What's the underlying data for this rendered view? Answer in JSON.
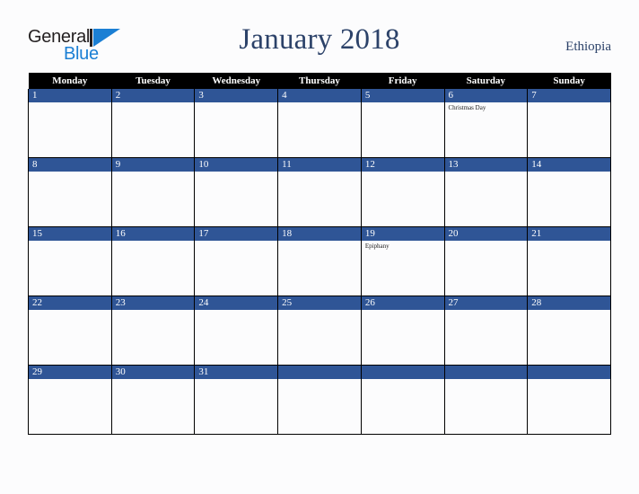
{
  "brand": {
    "name_part1": "General",
    "name_part2": "Blue",
    "mark_icon": "triangle-flag-icon",
    "color_dark": "#231f20",
    "color_blue": "#1b7fd4"
  },
  "header": {
    "title": "January 2018",
    "country": "Ethiopia",
    "title_color": "#2c4269"
  },
  "calendar": {
    "month": "January",
    "year": "2018",
    "week_start": "Monday",
    "weekdays": [
      "Monday",
      "Tuesday",
      "Wednesday",
      "Thursday",
      "Friday",
      "Saturday",
      "Sunday"
    ],
    "header_bg": "#000000",
    "header_fg": "#ffffff",
    "daynum_bg": "#2f5596",
    "daynum_fg": "#ffffff",
    "cell_bg": "#fcfcfd",
    "border_color": "#000000",
    "weeks": [
      [
        {
          "day": "1",
          "events": []
        },
        {
          "day": "2",
          "events": []
        },
        {
          "day": "3",
          "events": []
        },
        {
          "day": "4",
          "events": []
        },
        {
          "day": "5",
          "events": []
        },
        {
          "day": "6",
          "events": [
            "Christmas Day"
          ]
        },
        {
          "day": "7",
          "events": []
        }
      ],
      [
        {
          "day": "8",
          "events": []
        },
        {
          "day": "9",
          "events": []
        },
        {
          "day": "10",
          "events": []
        },
        {
          "day": "11",
          "events": []
        },
        {
          "day": "12",
          "events": []
        },
        {
          "day": "13",
          "events": []
        },
        {
          "day": "14",
          "events": []
        }
      ],
      [
        {
          "day": "15",
          "events": []
        },
        {
          "day": "16",
          "events": []
        },
        {
          "day": "17",
          "events": []
        },
        {
          "day": "18",
          "events": []
        },
        {
          "day": "19",
          "events": [
            "Epiphany"
          ]
        },
        {
          "day": "20",
          "events": []
        },
        {
          "day": "21",
          "events": []
        }
      ],
      [
        {
          "day": "22",
          "events": []
        },
        {
          "day": "23",
          "events": []
        },
        {
          "day": "24",
          "events": []
        },
        {
          "day": "25",
          "events": []
        },
        {
          "day": "26",
          "events": []
        },
        {
          "day": "27",
          "events": []
        },
        {
          "day": "28",
          "events": []
        }
      ],
      [
        {
          "day": "29",
          "events": []
        },
        {
          "day": "30",
          "events": []
        },
        {
          "day": "31",
          "events": []
        },
        {
          "day": "",
          "events": []
        },
        {
          "day": "",
          "events": []
        },
        {
          "day": "",
          "events": []
        },
        {
          "day": "",
          "events": []
        }
      ]
    ]
  }
}
